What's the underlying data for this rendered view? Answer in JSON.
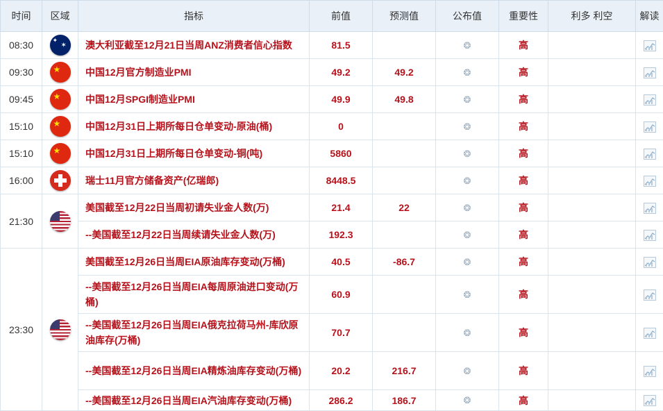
{
  "headers": {
    "time": "时间",
    "region": "区域",
    "indicator": "指标",
    "prev": "前值",
    "forecast": "预测值",
    "actual": "公布值",
    "importance": "重要性",
    "effect": "利多 利空",
    "analysis": "解读"
  },
  "rows": [
    {
      "time": "08:30",
      "flag": "AU",
      "indicator": "澳大利亚截至12月21日当周ANZ消费者信心指数",
      "prev": "81.5",
      "forecast": "",
      "importance": "高"
    },
    {
      "time": "09:30",
      "flag": "CN",
      "indicator": "中国12月官方制造业PMI",
      "prev": "49.2",
      "forecast": "49.2",
      "importance": "高"
    },
    {
      "time": "09:45",
      "flag": "CN",
      "indicator": "中国12月SPGI制造业PMI",
      "prev": "49.9",
      "forecast": "49.8",
      "importance": "高"
    },
    {
      "time": "15:10",
      "flag": "CN",
      "indicator": "中国12月31日上期所每日仓单变动-原油(桶)",
      "prev": "0",
      "forecast": "",
      "importance": "高"
    },
    {
      "time": "15:10",
      "flag": "CN",
      "indicator": "中国12月31日上期所每日仓单变动-铜(吨)",
      "prev": "5860",
      "forecast": "",
      "importance": "高"
    },
    {
      "time": "16:00",
      "flag": "CH",
      "indicator": "瑞士11月官方储备资产(亿瑞郎)",
      "prev": "8448.5",
      "forecast": "",
      "importance": "高"
    },
    {
      "time": "21:30",
      "flag": "US",
      "indicator": "美国截至12月22日当周初请失业金人数(万)",
      "prev": "21.4",
      "forecast": "22",
      "importance": "高"
    },
    {
      "indicator": "--美国截至12月22日当周续请失业金人数(万)",
      "prev": "192.3",
      "forecast": "",
      "importance": "高"
    },
    {
      "time": "23:30",
      "flag": "US",
      "indicator": "美国截至12月26日当周EIA原油库存变动(万桶)",
      "prev": "40.5",
      "forecast": "-86.7",
      "importance": "高"
    },
    {
      "indicator": "--美国截至12月26日当周EIA每周原油进口变动(万桶)",
      "prev": "60.9",
      "forecast": "",
      "importance": "高"
    },
    {
      "indicator": "--美国截至12月26日当周EIA俄克拉荷马州-库欣原油库存(万桶)",
      "prev": "70.7",
      "forecast": "",
      "importance": "高"
    },
    {
      "indicator": "--美国截至12月26日当周EIA精炼油库存变动(万桶)",
      "prev": "20.2",
      "forecast": "216.7",
      "importance": "高"
    },
    {
      "indicator": "--美国截至12月26日当周EIA汽油库存变动(万桶)",
      "prev": "286.2",
      "forecast": "186.7",
      "importance": "高"
    }
  ],
  "icons": {
    "actual": "loading-spinner-icon",
    "analysis": "chart-analysis-icon"
  }
}
